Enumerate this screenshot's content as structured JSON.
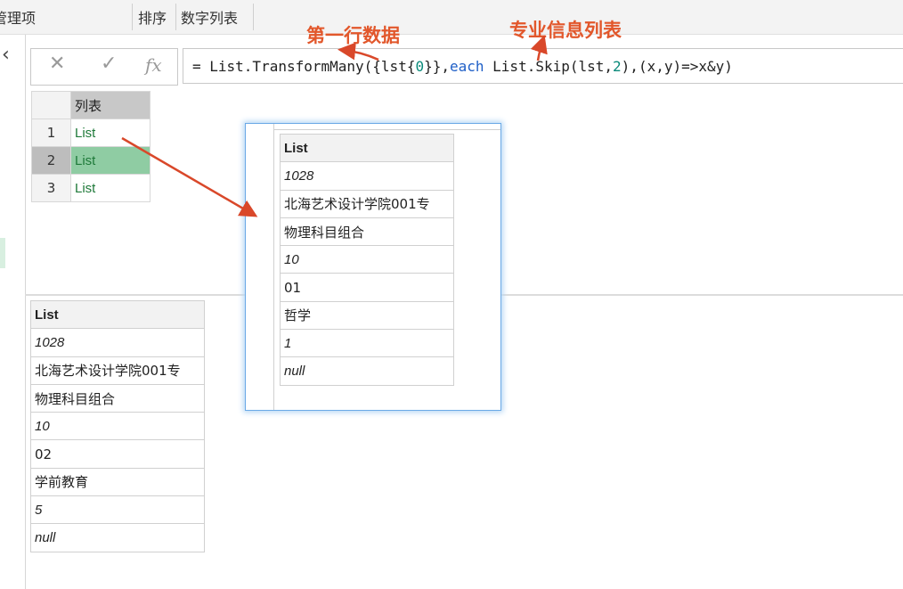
{
  "ribbon": {
    "group_manage": "管理项",
    "sort": "排序",
    "numeric_list": "数字列表"
  },
  "formula_bar": {
    "cancel_icon": "✕",
    "confirm_icon": "✓",
    "fx_icon": "fx",
    "formula_parts": [
      "= List.TransformMany({lst{",
      "0",
      "}},",
      "each",
      " List.Skip(lst,",
      "2",
      "),(x,y)=>x&y)"
    ]
  },
  "annotations": {
    "first_row": "第一行数据",
    "major_info": "专业信息列表"
  },
  "query_table": {
    "header": "列表",
    "rows": [
      {
        "index": "1",
        "value": "List"
      },
      {
        "index": "2",
        "value": "List"
      },
      {
        "index": "3",
        "value": "List"
      }
    ],
    "selected_row": 2
  },
  "popup_preview": {
    "header": "List",
    "items": [
      "1028",
      "北海艺术设计学院001专",
      "物理科目组合",
      "10",
      "01",
      "哲学",
      "1",
      "null"
    ]
  },
  "bottom_preview": {
    "header": "List",
    "items": [
      "1028",
      "北海艺术设计学院001专",
      "物理科目组合",
      "10",
      "02",
      "学前教育",
      "5",
      "null"
    ]
  },
  "colors": {
    "annotation": "#e2572b",
    "selected_row": "#8fcca3",
    "keyword": "#1f5fc7",
    "list_link": "#1f7a3a"
  }
}
